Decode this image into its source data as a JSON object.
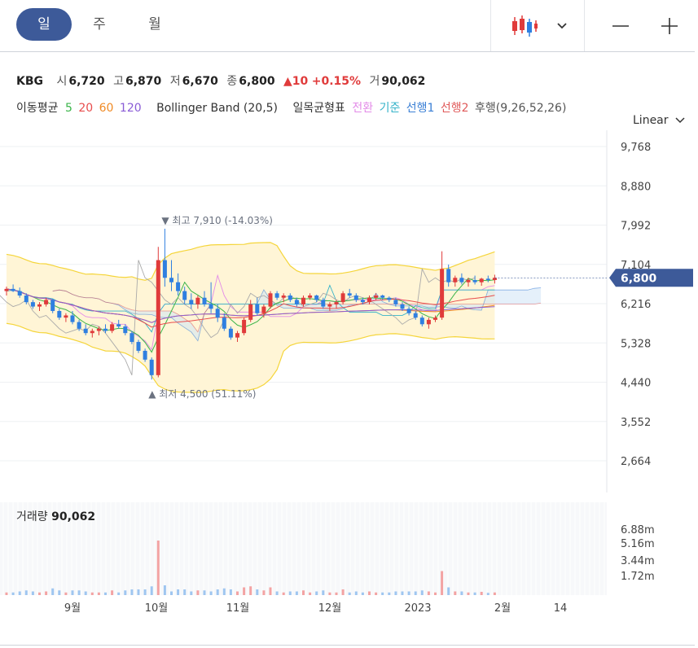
{
  "tabs": [
    {
      "label": "일",
      "active": true
    },
    {
      "label": "주",
      "active": false
    },
    {
      "label": "월",
      "active": false
    }
  ],
  "toolbar": {
    "chart_icon": "candlestick-icon",
    "dropdown_icon": "chevron-down-icon",
    "zoom_out": "minus-icon",
    "zoom_in": "plus-icon"
  },
  "quote": {
    "symbol": "KBG",
    "open_label": "시",
    "open": "6,720",
    "high_label": "고",
    "high": "6,870",
    "low_label": "저",
    "low": "6,670",
    "close_label": "종",
    "close": "6,800",
    "change": "▲10",
    "change_pct": "+0.15%",
    "volume_label": "거",
    "volume": "90,062"
  },
  "indicators": {
    "ma_label": "이동평균",
    "ma": [
      {
        "label": "5",
        "color": "#3bb54a"
      },
      {
        "label": "20",
        "color": "#e84d4d"
      },
      {
        "label": "60",
        "color": "#f08a24"
      },
      {
        "label": "120",
        "color": "#8a5cd6"
      }
    ],
    "bb_label": "Bollinger Band (20,5)",
    "ichimoku_label": "일목균형표",
    "ichimoku": [
      {
        "label": "전환",
        "color": "#e38be8"
      },
      {
        "label": "기준",
        "color": "#36b3c9"
      },
      {
        "label": "선행1",
        "color": "#3a7fd5"
      },
      {
        "label": "선행2",
        "color": "#e05a5a"
      },
      {
        "label": "후행(9,26,52,26)",
        "color": "#555555"
      }
    ]
  },
  "scale_label": "Linear",
  "colors": {
    "up": "#e03b3b",
    "down": "#2f7fe0",
    "band": "#fff5d6",
    "band_line": "#f5d53a",
    "price_badge": "#3d5a99"
  },
  "chart_data": {
    "type": "candlestick",
    "y_ticks": [
      "9,768",
      "8,880",
      "7,992",
      "7,104",
      "6,216",
      "5,328",
      "4,440",
      "3,552",
      "2,664"
    ],
    "x_ticks": [
      "9월",
      "10월",
      "11월",
      "12월",
      "2023",
      "2월",
      "14"
    ],
    "last_price": "6,800",
    "high_annotation": "▼ 최고 7,910 (-14.03%)",
    "low_annotation": "▲ 최저 4,500 (51.11%)",
    "ohlc": [
      [
        6500,
        6600,
        6400,
        6550
      ],
      [
        6550,
        6650,
        6480,
        6500
      ],
      [
        6500,
        6580,
        6350,
        6400
      ],
      [
        6400,
        6450,
        6200,
        6250
      ],
      [
        6250,
        6300,
        6100,
        6150
      ],
      [
        6150,
        6250,
        6050,
        6200
      ],
      [
        6200,
        6350,
        6150,
        6300
      ],
      [
        6300,
        6320,
        6000,
        6050
      ],
      [
        6050,
        6100,
        5850,
        5900
      ],
      [
        5900,
        6000,
        5800,
        5950
      ],
      [
        5950,
        6050,
        5750,
        5800
      ],
      [
        5800,
        5850,
        5600,
        5650
      ],
      [
        5650,
        5750,
        5500,
        5550
      ],
      [
        5550,
        5650,
        5450,
        5600
      ],
      [
        5600,
        5700,
        5500,
        5650
      ],
      [
        5650,
        5750,
        5550,
        5600
      ],
      [
        5600,
        5800,
        5550,
        5750
      ],
      [
        5750,
        5850,
        5650,
        5700
      ],
      [
        5700,
        5750,
        5500,
        5550
      ],
      [
        5550,
        5600,
        5300,
        5350
      ],
      [
        5350,
        5400,
        5100,
        5150
      ],
      [
        5150,
        5200,
        4900,
        4950
      ],
      [
        4950,
        5000,
        4500,
        4600
      ],
      [
        4600,
        7500,
        4550,
        7200
      ],
      [
        7200,
        7910,
        6600,
        6800
      ],
      [
        6800,
        7200,
        6500,
        6700
      ],
      [
        6700,
        6900,
        6400,
        6500
      ],
      [
        6500,
        6600,
        6200,
        6300
      ],
      [
        6300,
        6450,
        6100,
        6200
      ],
      [
        6200,
        6400,
        6100,
        6350
      ],
      [
        6350,
        6500,
        6150,
        6200
      ],
      [
        6200,
        6700,
        6000,
        6100
      ],
      [
        6100,
        6200,
        5800,
        5900
      ],
      [
        5900,
        6000,
        5600,
        5650
      ],
      [
        5650,
        5700,
        5400,
        5450
      ],
      [
        5450,
        5600,
        5350,
        5550
      ],
      [
        5550,
        5900,
        5500,
        5850
      ],
      [
        5850,
        6300,
        5800,
        6200
      ],
      [
        6200,
        6350,
        5950,
        6000
      ],
      [
        6000,
        6200,
        5900,
        6150
      ],
      [
        6150,
        6500,
        6100,
        6450
      ],
      [
        6450,
        6500,
        6300,
        6350
      ],
      [
        6350,
        6450,
        6250,
        6400
      ],
      [
        6400,
        6450,
        6250,
        6300
      ],
      [
        6300,
        6350,
        6150,
        6200
      ],
      [
        6200,
        6400,
        6150,
        6350
      ],
      [
        6350,
        6450,
        6300,
        6400
      ],
      [
        6400,
        6420,
        6250,
        6300
      ],
      [
        6300,
        6350,
        6100,
        6150
      ],
      [
        6150,
        6250,
        6050,
        6200
      ],
      [
        6200,
        6300,
        6100,
        6250
      ],
      [
        6250,
        6500,
        6200,
        6450
      ],
      [
        6450,
        6550,
        6350,
        6400
      ],
      [
        6400,
        6450,
        6250,
        6300
      ],
      [
        6300,
        6350,
        6200,
        6250
      ],
      [
        6250,
        6400,
        6200,
        6350
      ],
      [
        6350,
        6450,
        6300,
        6400
      ],
      [
        6400,
        6420,
        6300,
        6350
      ],
      [
        6350,
        6380,
        6250,
        6300
      ],
      [
        6300,
        6350,
        6150,
        6200
      ],
      [
        6200,
        6250,
        6050,
        6100
      ],
      [
        6100,
        6150,
        5950,
        6000
      ],
      [
        6000,
        6050,
        5850,
        5900
      ],
      [
        5900,
        5950,
        5700,
        5750
      ],
      [
        5750,
        5900,
        5650,
        5850
      ],
      [
        5850,
        5950,
        5800,
        5900
      ],
      [
        5900,
        7400,
        5850,
        7000
      ],
      [
        7000,
        7100,
        6600,
        6700
      ],
      [
        6700,
        6850,
        6600,
        6800
      ],
      [
        6800,
        6900,
        6650,
        6700
      ],
      [
        6700,
        6800,
        6600,
        6750
      ],
      [
        6750,
        6850,
        6650,
        6700
      ],
      [
        6700,
        6800,
        6620,
        6780
      ],
      [
        6780,
        6850,
        6700,
        6750
      ],
      [
        6750,
        6870,
        6670,
        6800
      ]
    ],
    "volume": {
      "label": "거래량",
      "value": "90,062",
      "y_ticks": [
        "6.88m",
        "5.16m",
        "3.44m",
        "1.72m"
      ]
    }
  }
}
